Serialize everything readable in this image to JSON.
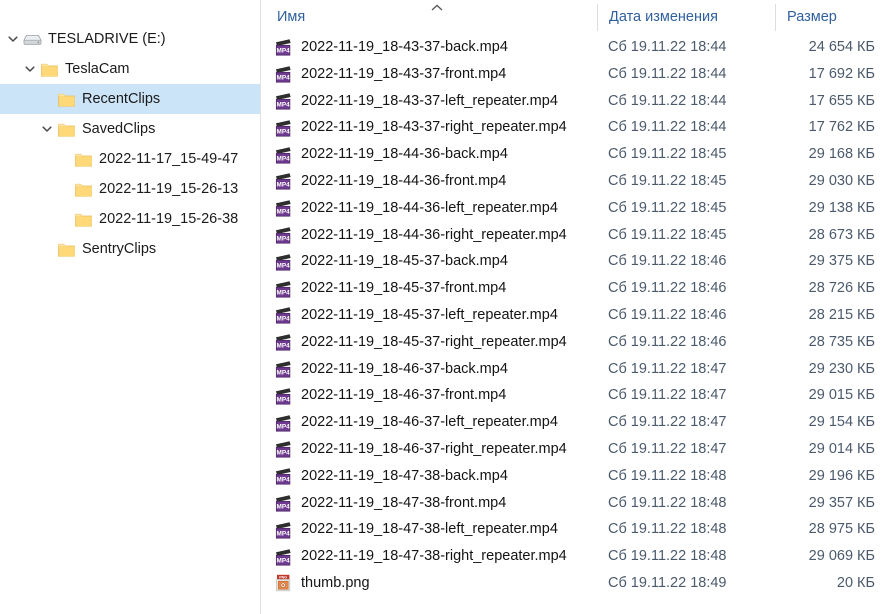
{
  "nav": {
    "items": [
      {
        "label": "TESLADRIVE (E:)",
        "depth": 0,
        "icon": "drive-icon",
        "expanded": true,
        "chevron": true,
        "selected": false
      },
      {
        "label": "TeslaCam",
        "depth": 1,
        "icon": "folder-icon",
        "expanded": true,
        "chevron": true,
        "selected": false
      },
      {
        "label": "RecentClips",
        "depth": 2,
        "icon": "folder-icon",
        "expanded": false,
        "chevron": false,
        "selected": true
      },
      {
        "label": "SavedClips",
        "depth": 2,
        "icon": "folder-icon",
        "expanded": true,
        "chevron": true,
        "selected": false
      },
      {
        "label": "2022-11-17_15-49-47",
        "depth": 3,
        "icon": "folder-icon",
        "expanded": false,
        "chevron": false,
        "selected": false
      },
      {
        "label": "2022-11-19_15-26-13",
        "depth": 3,
        "icon": "folder-icon",
        "expanded": false,
        "chevron": false,
        "selected": false
      },
      {
        "label": "2022-11-19_15-26-38",
        "depth": 3,
        "icon": "folder-icon",
        "expanded": false,
        "chevron": false,
        "selected": false
      },
      {
        "label": "SentryClips",
        "depth": 2,
        "icon": "folder-icon",
        "expanded": false,
        "chevron": false,
        "selected": false
      }
    ]
  },
  "list": {
    "columns": {
      "name": "Имя",
      "date": "Дата изменения",
      "size": "Размер"
    },
    "sort": {
      "column": "name",
      "direction": "ascending",
      "icon": "chevron-up-icon"
    },
    "rows": [
      {
        "name": "2022-11-19_18-43-37-back.mp4",
        "icon": "mp4-file-icon",
        "date": "Сб 19.11.22 18:44",
        "size": "24 654 КБ"
      },
      {
        "name": "2022-11-19_18-43-37-front.mp4",
        "icon": "mp4-file-icon",
        "date": "Сб 19.11.22 18:44",
        "size": "17 692 КБ"
      },
      {
        "name": "2022-11-19_18-43-37-left_repeater.mp4",
        "icon": "mp4-file-icon",
        "date": "Сб 19.11.22 18:44",
        "size": "17 655 КБ"
      },
      {
        "name": "2022-11-19_18-43-37-right_repeater.mp4",
        "icon": "mp4-file-icon",
        "date": "Сб 19.11.22 18:44",
        "size": "17 762 КБ"
      },
      {
        "name": "2022-11-19_18-44-36-back.mp4",
        "icon": "mp4-file-icon",
        "date": "Сб 19.11.22 18:45",
        "size": "29 168 КБ"
      },
      {
        "name": "2022-11-19_18-44-36-front.mp4",
        "icon": "mp4-file-icon",
        "date": "Сб 19.11.22 18:45",
        "size": "29 030 КБ"
      },
      {
        "name": "2022-11-19_18-44-36-left_repeater.mp4",
        "icon": "mp4-file-icon",
        "date": "Сб 19.11.22 18:45",
        "size": "29 138 КБ"
      },
      {
        "name": "2022-11-19_18-44-36-right_repeater.mp4",
        "icon": "mp4-file-icon",
        "date": "Сб 19.11.22 18:45",
        "size": "28 673 КБ"
      },
      {
        "name": "2022-11-19_18-45-37-back.mp4",
        "icon": "mp4-file-icon",
        "date": "Сб 19.11.22 18:46",
        "size": "29 375 КБ"
      },
      {
        "name": "2022-11-19_18-45-37-front.mp4",
        "icon": "mp4-file-icon",
        "date": "Сб 19.11.22 18:46",
        "size": "28 726 КБ"
      },
      {
        "name": "2022-11-19_18-45-37-left_repeater.mp4",
        "icon": "mp4-file-icon",
        "date": "Сб 19.11.22 18:46",
        "size": "28 215 КБ"
      },
      {
        "name": "2022-11-19_18-45-37-right_repeater.mp4",
        "icon": "mp4-file-icon",
        "date": "Сб 19.11.22 18:46",
        "size": "28 735 КБ"
      },
      {
        "name": "2022-11-19_18-46-37-back.mp4",
        "icon": "mp4-file-icon",
        "date": "Сб 19.11.22 18:47",
        "size": "29 230 КБ"
      },
      {
        "name": "2022-11-19_18-46-37-front.mp4",
        "icon": "mp4-file-icon",
        "date": "Сб 19.11.22 18:47",
        "size": "29 015 КБ"
      },
      {
        "name": "2022-11-19_18-46-37-left_repeater.mp4",
        "icon": "mp4-file-icon",
        "date": "Сб 19.11.22 18:47",
        "size": "29 154 КБ"
      },
      {
        "name": "2022-11-19_18-46-37-right_repeater.mp4",
        "icon": "mp4-file-icon",
        "date": "Сб 19.11.22 18:47",
        "size": "29 014 КБ"
      },
      {
        "name": "2022-11-19_18-47-38-back.mp4",
        "icon": "mp4-file-icon",
        "date": "Сб 19.11.22 18:48",
        "size": "29 196 КБ"
      },
      {
        "name": "2022-11-19_18-47-38-front.mp4",
        "icon": "mp4-file-icon",
        "date": "Сб 19.11.22 18:48",
        "size": "29 357 КБ"
      },
      {
        "name": "2022-11-19_18-47-38-left_repeater.mp4",
        "icon": "mp4-file-icon",
        "date": "Сб 19.11.22 18:48",
        "size": "28 975 КБ"
      },
      {
        "name": "2022-11-19_18-47-38-right_repeater.mp4",
        "icon": "mp4-file-icon",
        "date": "Сб 19.11.22 18:48",
        "size": "29 069 КБ"
      },
      {
        "name": "thumb.png",
        "icon": "png-file-icon",
        "date": "Сб 19.11.22 18:49",
        "size": "20 КБ"
      }
    ]
  },
  "colors": {
    "selection": "#cce4f7",
    "header_text": "#30609e",
    "name_text": "#141414",
    "meta_text": "#4b5a6b",
    "divider": "#e2e2e2",
    "mp4_badge": "#6d3a8f",
    "png_badge": "#c0392b"
  }
}
